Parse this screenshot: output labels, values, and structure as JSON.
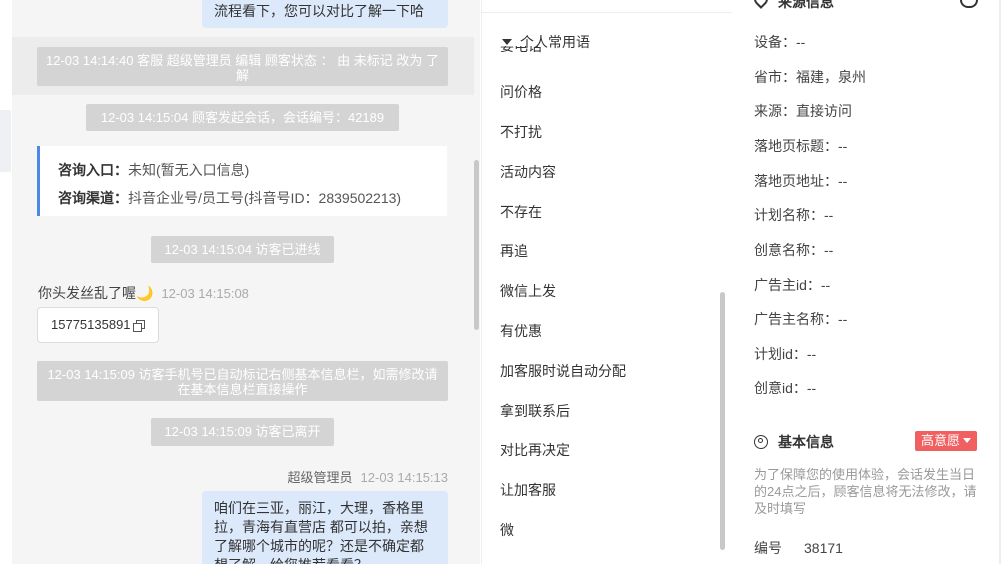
{
  "chat": {
    "top_bubble": "流程看下，您可以对比了解一下哈",
    "sys_status": "12-03 14:14:40 客服 超级管理员 编辑 顾客状态 ： 由 未标记 改为 了解",
    "sys_session": "12-03 14:15:04 顾客发起会话，会话编号：42189",
    "card": {
      "entry_label": "咨询入口：",
      "entry_value": "未知(暂无入口信息)",
      "channel_label": "咨询渠道：",
      "channel_value": "抖音企业号/员工号(抖音号ID：2839502213)"
    },
    "sys_enter": "12-03 14:15:04 访客已进线",
    "visitor_msg": "你头发丝乱了喔🌙",
    "visitor_time": "12-03 14:15:08",
    "phone": "15775135891",
    "sys_phone": "12-03 14:15:09 访客手机号已自动标记右侧基本信息栏，如需修改请在基本信息栏直接操作",
    "sys_leave": "12-03 14:15:09 访客已离开",
    "agent_name": "超级管理员",
    "agent_time": "12-03 14:15:13",
    "agent_bubble": "咱们在三亚，丽江，大理，香格里拉，青海有直营店 都可以拍，亲想了解哪个城市的呢？还是不确定都想了解，给您推荐看看？"
  },
  "phrases": {
    "group_label": "个人常用语",
    "cut_item": "要电话",
    "items": [
      "问价格",
      "不打扰",
      "活动内容",
      "不存在",
      "再追",
      "微信上发",
      "有优惠",
      "加客服时说自动分配",
      "拿到联系后",
      "对比再决定",
      "让加客服",
      "微"
    ]
  },
  "info": {
    "source_title": "来源信息",
    "rows": [
      "设备：--",
      "省市：福建，泉州",
      "来源：直接访问",
      "落地页标题：--",
      "落地页地址：--",
      "计划名称：--",
      "创意名称：--",
      "广告主id：--",
      "广告主名称：--",
      "计划id：--",
      "创意id：--"
    ],
    "basic_title": "基本信息",
    "intent_badge": "高意愿",
    "note": "为了保障您的使用体验，会话发生当日的24点之后，顾客信息将无法修改，请及时填写",
    "id_label": "编号",
    "id_value": "38171"
  },
  "colors": {
    "accent_blue": "#4a8ae6",
    "bubble_blue": "#dbe9fb",
    "badge_red": "#f06060"
  }
}
